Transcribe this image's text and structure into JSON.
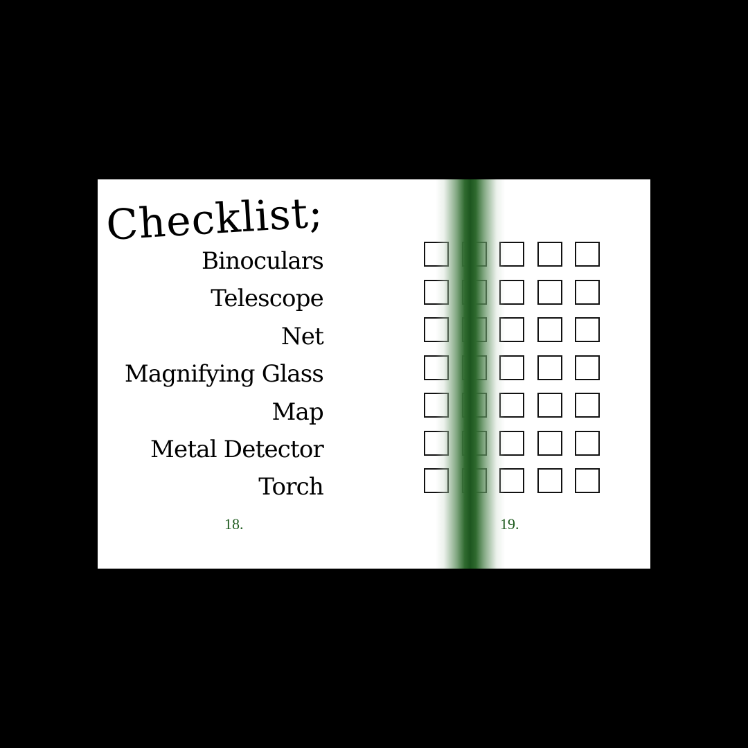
{
  "colors": {
    "background": "#000000",
    "page": "#ffffff",
    "gutter": "#1d561f",
    "folio": "#1d5a1d"
  },
  "left_page": {
    "title": "Checklist;",
    "items": [
      "Binoculars",
      "Telescope",
      "Net",
      "Magnifying Glass",
      "Map",
      "Metal Detector",
      "Torch"
    ],
    "page_number": "18."
  },
  "right_page": {
    "checkbox_rows": 7,
    "checkbox_columns": 5,
    "page_number": "19."
  }
}
